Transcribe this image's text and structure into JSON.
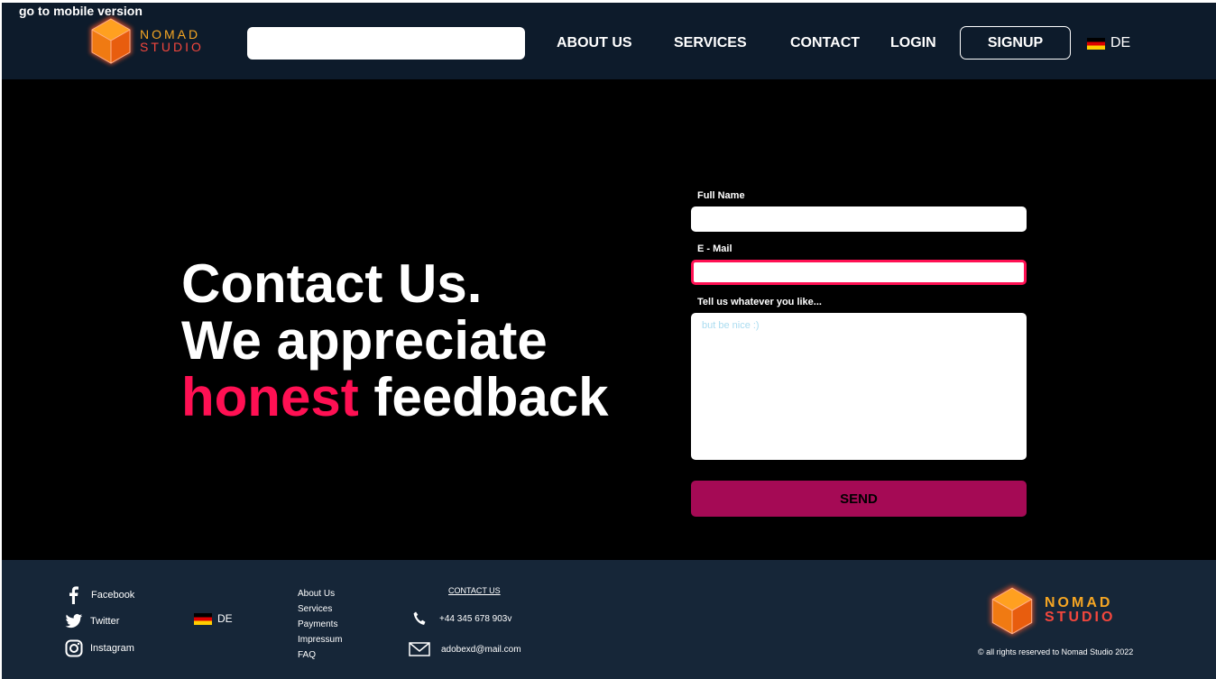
{
  "mobile_link": "go to mobile version",
  "brand": {
    "line1": "NOMAD",
    "line2": "STUDIO"
  },
  "search": {
    "placeholder": ""
  },
  "nav": {
    "about": "ABOUT US",
    "services": "SERVICES",
    "contact": "CONTACT",
    "login": "LOGIN",
    "signup": "SIGNUP"
  },
  "lang": "DE",
  "hero": {
    "line1": "Contact Us.",
    "line2": "We appreciate",
    "accent": "honest",
    "rest": " feedback"
  },
  "form": {
    "name_label": "Full Name",
    "email_label": "E - Mail",
    "message_label": "Tell us whatever you like...",
    "message_placeholder": "but be nice :)",
    "send_label": "SEND"
  },
  "footer": {
    "social": [
      "Facebook",
      "Twitter",
      "Instagram"
    ],
    "links": [
      "About Us",
      "Services",
      "Payments",
      "Impressum",
      "FAQ"
    ],
    "contact_title": "CONTACT US",
    "phone": "+44 345 678 903v",
    "email": "adobexd@mail.com",
    "copyright": "© all rights reserved to Nomad Studio 2022"
  },
  "colors": {
    "accent": "#ff1053",
    "header_bg": "#0d1b2b",
    "footer_bg": "#162638",
    "send_bg": "#a50a55"
  }
}
